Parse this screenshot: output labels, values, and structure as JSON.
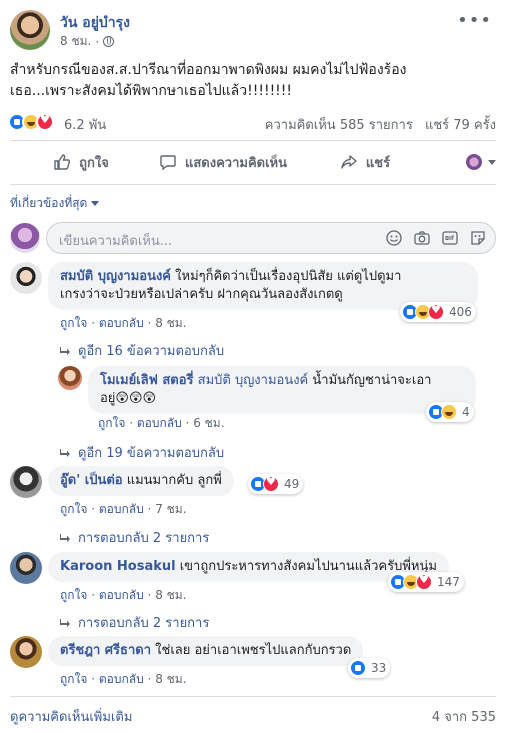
{
  "post": {
    "author": "วัน อยู่บำรุง",
    "time": "8 ชม.",
    "more_icon": "more-dots-icon",
    "privacy_icon": "globe-icon",
    "text_line1": "สำหรับกรณีของส.ส.ปารีณาที่ออกมาพาดพิงผม ผมคงไม่ไปฟ้องร้อง",
    "text_line2": "เธอ...เพราะสังคมได้พิพากษาเธอไปแล้ว!!!!!!!!",
    "reaction_count": "6.2 พัน",
    "comments_count": "ความคิดเห็น 585 รายการ",
    "shares_count": "แชร์ 79 ครั้ง"
  },
  "actions": {
    "like": "ถูกใจ",
    "comment": "แสดงความคิดเห็น",
    "share": "แชร์"
  },
  "filter": {
    "label": "ที่เกี่ยวข้องที่สุด"
  },
  "composer": {
    "placeholder": "เขียนความคิดเห็น..."
  },
  "comments": [
    {
      "name": "สมบัติ บุญงามอนงค์",
      "text_line1": " ใหม่ๆก็คิดว่าเป็นเรื่องอุปนิสัย แต่ดูไปดูมา",
      "text_line2": "เกรงว่าจะป่วยหรือเปล่าครับ ฝากคุณวันลองสังเกตดู",
      "like": "ถูกใจ",
      "reply": "ตอบกลับ",
      "time": "8 ชม.",
      "reactions": "406",
      "replies_link": "ดูอีก 16 ข้อความตอบกลับ"
    },
    {
      "name": "โมเมย์เลิฟ สตอรี่",
      "tag": " สมบัติ บุญงามอนงค์",
      "text_line1": " น้ำมันกัญชาน่าจะเอา",
      "text_line2": "อยู่😲😲😲",
      "like": "ถูกใจ",
      "reply": "ตอบกลับ",
      "time": "6 ชม.",
      "reactions": "4",
      "replies_link": "ดูอีก 19 ข้อความตอบกลับ"
    },
    {
      "name": "อู๊ด' เป็นต่อ",
      "text_line1": " แมนมากคับ ลูกพี่",
      "like": "ถูกใจ",
      "reply": "ตอบกลับ",
      "time": "7 ชม.",
      "reactions": "49",
      "replies_link": "การตอบกลับ 2 รายการ"
    },
    {
      "name": "Karoon Hosakul",
      "text_line1": " เขาถูกประหารทางสังคมไปนานแล้วครับพี่หนุ่ม",
      "like": "ถูกใจ",
      "reply": "ตอบกลับ",
      "time": "8 ชม.",
      "reactions": "147",
      "replies_link": "การตอบกลับ 2 รายการ"
    },
    {
      "name": "ตรีชฎา ศรีธาดา",
      "text_line1": " ใช่เลย อย่าเอาเพชรไปแลกกับกรวด",
      "like": "ถูกใจ",
      "reply": "ตอบกลับ",
      "time": "8 ชม.",
      "reactions": "33"
    }
  ],
  "footer": {
    "view_more": "ดูความคิดเห็นเพิ่มเติม",
    "pager": "4 จาก 535"
  },
  "colors": {
    "link": "#385898",
    "like_blue": "#1877f2",
    "love_red": "#f0284a",
    "haha_yellow": "#f7c94b",
    "muted": "#606770",
    "bubble": "#f2f3f5"
  }
}
